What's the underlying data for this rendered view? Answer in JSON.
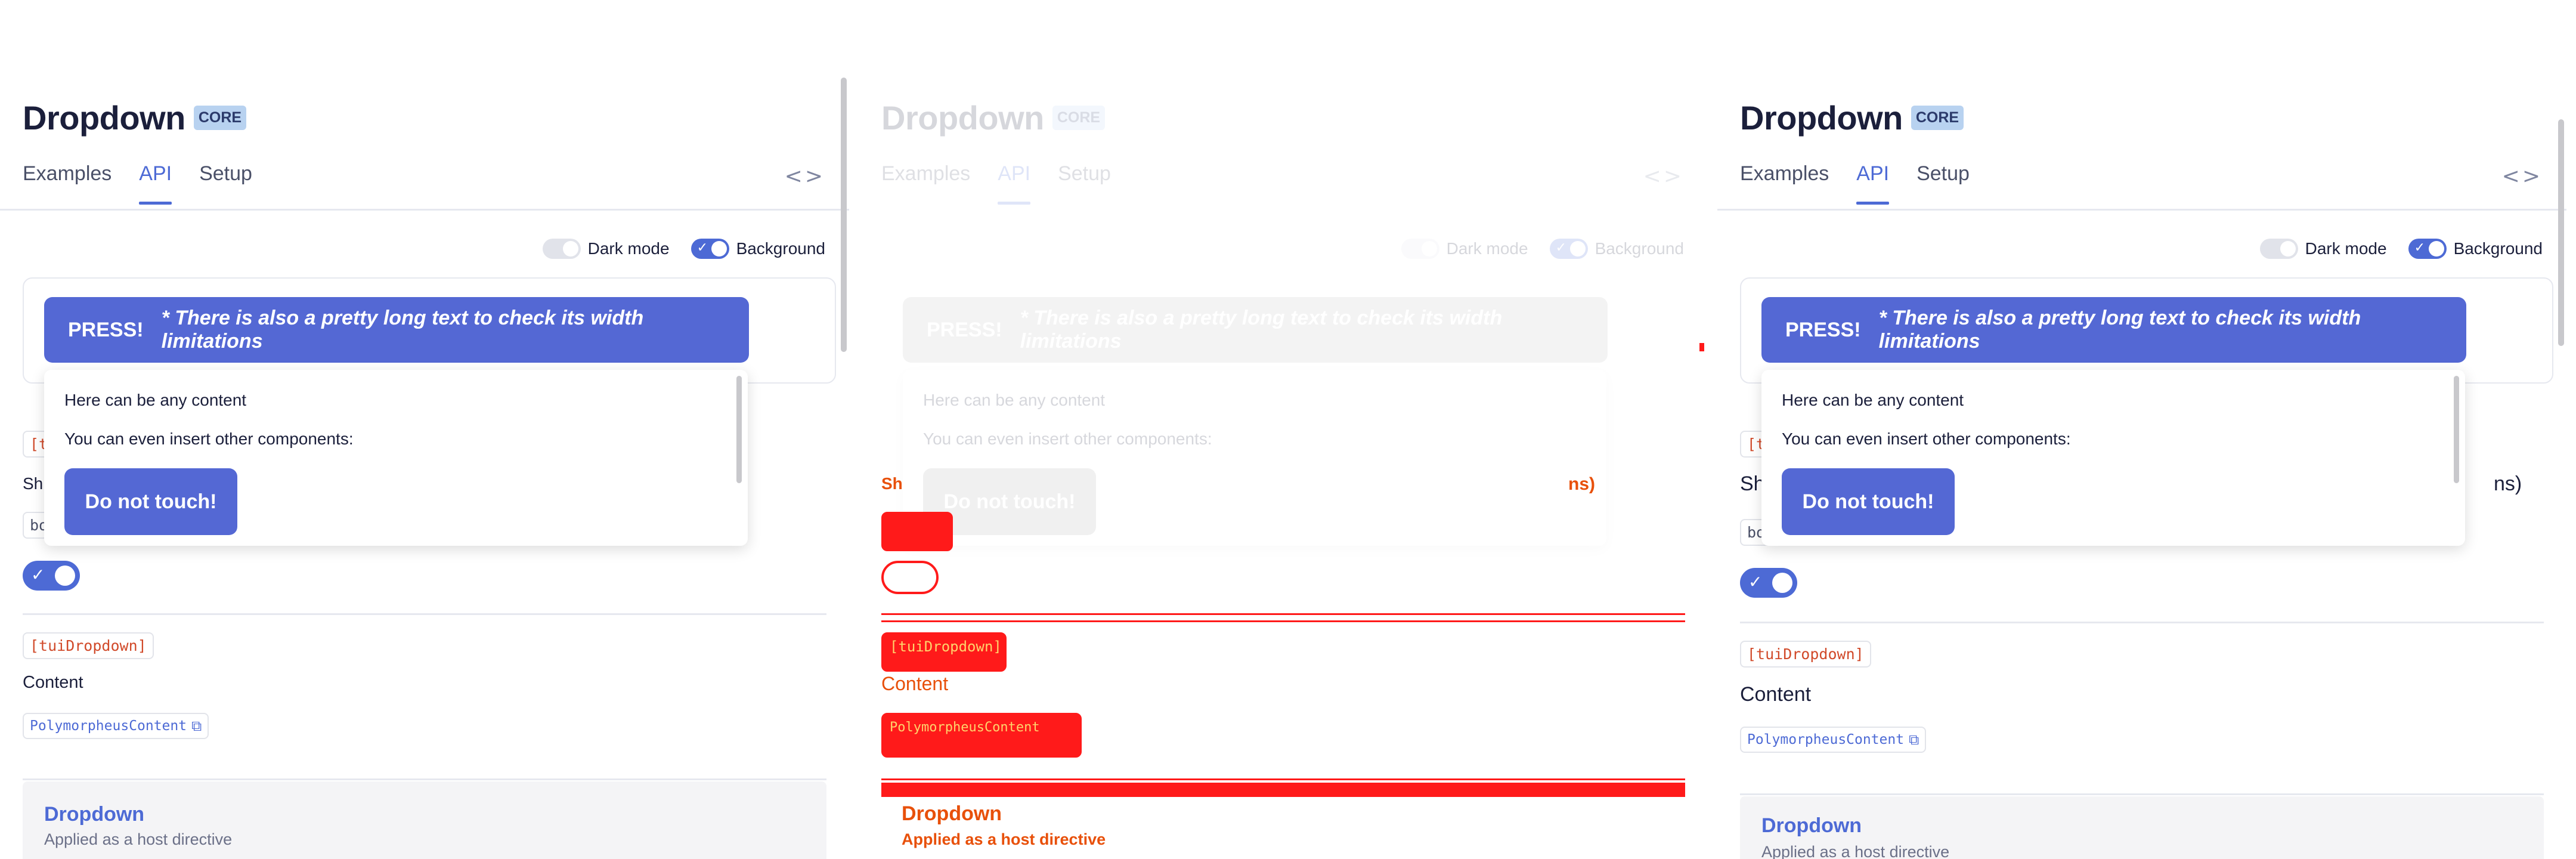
{
  "page": {
    "title": "Dropdown",
    "badge": "CORE",
    "tabs": [
      {
        "label": "Examples",
        "active": false
      },
      {
        "label": "API",
        "active": true
      },
      {
        "label": "Setup",
        "active": false
      }
    ],
    "code_toggle": "<>"
  },
  "demo": {
    "dark_mode_label": "Dark mode",
    "background_label": "Background",
    "press_label": "PRESS!",
    "press_note": "* There is also a pretty long text to check its width limitations",
    "dropdown_line1": "Here can be any content",
    "dropdown_line2": "You can even insert other components:",
    "touch_label": "Do not touch!"
  },
  "api": {
    "chip_left": "[t",
    "partial_sh": "Sh",
    "partial_bo": "bo",
    "partial_ns": "ns)",
    "tui_dropdown": "[tuiDropdown]",
    "content_label": "Content",
    "poly_chip": "PolymorpheusContent",
    "directive_title": "Dropdown",
    "directive_sub": "Applied as a host directive"
  },
  "colors": {
    "accent": "#4d6ad5",
    "button": "#5468d4",
    "badge": "#b8d2f0",
    "code_red": "#d14a2a",
    "diff_red": "#ff1a1a",
    "diff_orange": "#e8500a"
  }
}
